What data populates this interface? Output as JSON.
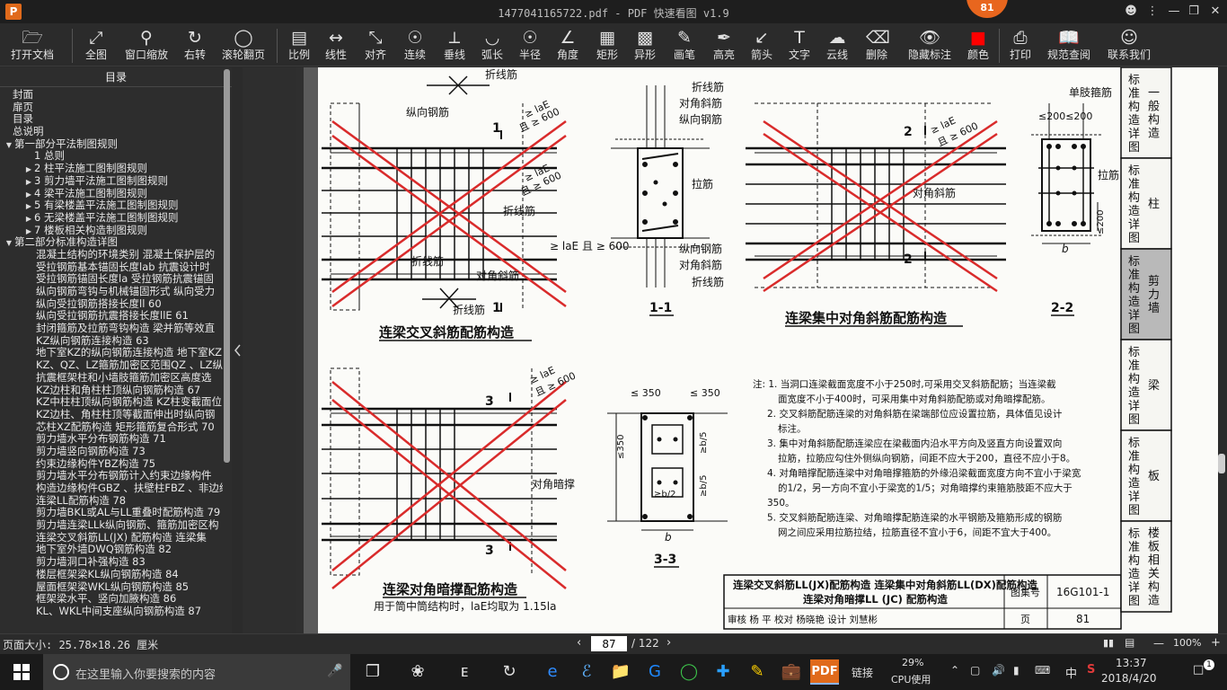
{
  "app": {
    "logo": "P",
    "title": "1477041165722.pdf - PDF 快速看图 v1.9",
    "badge": "81"
  },
  "toolbar": {
    "items": [
      {
        "label": "打开文档",
        "icon": "folder-icon"
      },
      {
        "label": "全图",
        "icon": "fit-all-icon"
      },
      {
        "label": "窗口缩放",
        "icon": "zoom-window-icon"
      },
      {
        "label": "右转",
        "icon": "rotate-right-icon"
      },
      {
        "label": "滚轮翻页",
        "icon": "mouse-wheel-icon"
      },
      {
        "label": "比例",
        "icon": "ruler-icon"
      },
      {
        "label": "线性",
        "icon": "linear-measure-icon"
      },
      {
        "label": "对齐",
        "icon": "aligned-measure-icon"
      },
      {
        "label": "连续",
        "icon": "continuous-measure-icon"
      },
      {
        "label": "垂线",
        "icon": "perpendicular-icon"
      },
      {
        "label": "弧长",
        "icon": "arc-length-icon"
      },
      {
        "label": "半径",
        "icon": "radius-icon"
      },
      {
        "label": "角度",
        "icon": "angle-icon"
      },
      {
        "label": "矩形",
        "icon": "rectangle-area-icon"
      },
      {
        "label": "异形",
        "icon": "polygon-area-icon"
      },
      {
        "label": "画笔",
        "icon": "pen-icon"
      },
      {
        "label": "高亮",
        "icon": "highlighter-icon"
      },
      {
        "label": "箭头",
        "icon": "arrow-icon"
      },
      {
        "label": "文字",
        "icon": "text-icon"
      },
      {
        "label": "云线",
        "icon": "cloud-line-icon"
      },
      {
        "label": "删除",
        "icon": "eraser-icon"
      },
      {
        "label": "隐藏标注",
        "icon": "hide-markup-icon"
      },
      {
        "label": "颜色",
        "icon": "color-swatch-icon"
      },
      {
        "label": "打印",
        "icon": "printer-icon"
      },
      {
        "label": "规范查阅",
        "icon": "book-icon"
      },
      {
        "label": "联系我们",
        "icon": "support-icon"
      }
    ],
    "color_swatch": "#ff0000"
  },
  "sidebar": {
    "title": "目录",
    "items": [
      {
        "level": 1,
        "toggle": "",
        "label": "封面"
      },
      {
        "level": 1,
        "toggle": "",
        "label": "扉页"
      },
      {
        "level": 1,
        "toggle": "",
        "label": "目录"
      },
      {
        "level": 1,
        "toggle": "",
        "label": "总说明"
      },
      {
        "level": 0,
        "toggle": "▼",
        "label": "第一部分平法制图规则"
      },
      {
        "level": 2,
        "toggle": "",
        "label": "1 总则"
      },
      {
        "level": 2,
        "toggle": "▶",
        "label": "2 柱平法施工图制图规则"
      },
      {
        "level": 2,
        "toggle": "▶",
        "label": "3 剪力墙平法施工图制图规则"
      },
      {
        "level": 2,
        "toggle": "▶",
        "label": "4 梁平法施工图制图规则"
      },
      {
        "level": 2,
        "toggle": "▶",
        "label": "5 有梁楼盖平法施工图制图规则"
      },
      {
        "level": 2,
        "toggle": "▶",
        "label": "6 无梁楼盖平法施工图制图规则"
      },
      {
        "level": 2,
        "toggle": "▶",
        "label": "7 楼板相关构造制图规则"
      },
      {
        "level": 0,
        "toggle": "▼",
        "label": "第二部分标准构造详图"
      },
      {
        "level": 3,
        "toggle": "",
        "label": "混凝土结构的环境类别  混凝土保护层的"
      },
      {
        "level": 3,
        "toggle": "",
        "label": "受拉钢筋基本锚固长度lab  抗震设计时"
      },
      {
        "level": 3,
        "toggle": "",
        "label": "受拉钢筋锚固长度la  受拉钢筋抗震锚固"
      },
      {
        "level": 3,
        "toggle": "",
        "label": "纵向钢筋弯钩与机械锚固形式  纵向受力"
      },
      {
        "level": 3,
        "toggle": "",
        "label": "纵向受拉钢筋搭接长度ll 60"
      },
      {
        "level": 3,
        "toggle": "",
        "label": "纵向受拉钢筋抗震搭接长度llE 61"
      },
      {
        "level": 3,
        "toggle": "",
        "label": "封闭箍筋及拉筋弯钩构造  梁并筋等效直"
      },
      {
        "level": 3,
        "toggle": "",
        "label": "KZ纵向钢筋连接构造 63"
      },
      {
        "level": 3,
        "toggle": "",
        "label": "地下室KZ的纵向钢筋连接构造  地下室KZ"
      },
      {
        "level": 3,
        "toggle": "",
        "label": "KZ、QZ、LZ箍筋加密区范围QZ 、LZ纵向"
      },
      {
        "level": 3,
        "toggle": "",
        "label": "抗震框架柱和小墙肢箍筋加密区高度选"
      },
      {
        "level": 3,
        "toggle": "",
        "label": "KZ边柱和角柱柱顶纵向钢筋构造 67"
      },
      {
        "level": 3,
        "toggle": "",
        "label": "KZ中柱柱顶纵向钢筋构造  KZ柱变截面位"
      },
      {
        "level": 3,
        "toggle": "",
        "label": "KZ边柱、角柱柱顶等截面伸出时纵向钢"
      },
      {
        "level": 3,
        "toggle": "",
        "label": "芯柱XZ配筋构造  矩形箍筋复合形式 70"
      },
      {
        "level": 3,
        "toggle": "",
        "label": "剪力墙水平分布钢筋构造 71"
      },
      {
        "level": 3,
        "toggle": "",
        "label": "剪力墙竖向钢筋构造 73"
      },
      {
        "level": 3,
        "toggle": "",
        "label": "约束边缘构件YBZ构造 75"
      },
      {
        "level": 3,
        "toggle": "",
        "label": "剪力墙水平分布钢筋计入约束边缘构件"
      },
      {
        "level": 3,
        "toggle": "",
        "label": "构造边缘构件GBZ 、扶壁柱FBZ 、非边缘"
      },
      {
        "level": 3,
        "toggle": "",
        "label": "连梁LL配筋构造 78"
      },
      {
        "level": 3,
        "toggle": "",
        "label": "剪力墙BKL或AL与LL重叠时配筋构造 79"
      },
      {
        "level": 3,
        "toggle": "",
        "label": "剪力墙连梁LLk纵向钢筋、箍筋加密区构"
      },
      {
        "level": 3,
        "toggle": "",
        "label": "连梁交叉斜筋LL(JX) 配筋构造  连梁集"
      },
      {
        "level": 3,
        "toggle": "",
        "label": "地下室外墙DWQ钢筋构造 82"
      },
      {
        "level": 3,
        "toggle": "",
        "label": "剪力墙洞口补强构造 83"
      },
      {
        "level": 3,
        "toggle": "",
        "label": "楼层框架梁KL纵向钢筋构造 84"
      },
      {
        "level": 3,
        "toggle": "",
        "label": "屋面框架梁WKL纵向钢筋构造 85"
      },
      {
        "level": 3,
        "toggle": "",
        "label": "框架梁水平、竖向加腋构造 86"
      },
      {
        "level": 3,
        "toggle": "",
        "label": "KL、WKL中间支座纵向钢筋构造 87"
      }
    ]
  },
  "drawing": {
    "fig1": {
      "title": "连梁交叉斜筋配筋构造",
      "labels": {
        "zhexianjin": "折线筋",
        "zongxiang": "纵向钢筋",
        "duijiao": "对角斜筋",
        "lae1": "≥ laE",
        "ge600": "且 ≥ 600",
        "lae_line": "≥ laE 且 ≥ 600",
        "sec": "1"
      }
    },
    "sec11": {
      "title": "1-1",
      "labels": [
        "折线筋",
        "对角斜筋",
        "纵向钢筋",
        "拉筋",
        "纵向钢筋",
        "对角斜筋",
        "折线筋"
      ]
    },
    "fig2": {
      "title": "连梁集中对角斜筋配筋构造",
      "labels": {
        "duijiao": "对角斜筋",
        "lae": "≥ laE",
        "ge600": "且 ≥ 600",
        "sec": "2"
      }
    },
    "sec22": {
      "title": "2-2",
      "labels": {
        "danzhi": "单肢箍筋",
        "spacing": "≤200≤200",
        "lajin": "拉筋",
        "dim200": "≤200",
        "b": "b"
      }
    },
    "fig3": {
      "title": "连梁对角暗撑配筋构造",
      "subtitle": "用于筒中筒结构时，laE均取为 1.15la",
      "labels": {
        "anchang": "对角暗撑",
        "lae": "≥ laE",
        "ge600": "且 ≥ 600",
        "sec": "3"
      }
    },
    "sec33": {
      "title": "3-3",
      "labels": {
        "s350a": "≤ 350",
        "s350b": "≤ 350",
        "v350": "≤350",
        "b5a": "≥b/5",
        "b5b": "≥b/5",
        "b2": "≥b/2",
        "b": "b"
      }
    },
    "notes": [
      "注: 1. 当洞口连梁截面宽度不小于250时,可采用交叉斜筋配筋；当连梁截",
      "面宽度不小于400时，可采用集中对角斜筋配筋或对角暗撑配筋。",
      "2. 交叉斜筋配筋连梁的对角斜筋在梁端部位应设置拉筋，具体值见设计",
      "标注。",
      "3. 集中对角斜筋配筋连梁应在梁截面内沿水平方向及竖直方向设置双向",
      "拉筋，拉筋应勾住外侧纵向钢筋，间距不应大于200，直径不应小于8。",
      "4. 对角暗撑配筋连梁中对角暗撑箍筋的外缘沿梁截面宽度方向不宜小于梁宽",
      "的1/2，另一方向不宜小于梁宽的1/5；对角暗撑约束箍筋肢距不应大于",
      "350。",
      "5. 交叉斜筋配筋连梁、对角暗撑配筋连梁的水平钢筋及箍筋形成的钢筋",
      "网之间应采用拉筋拉结，拉筋直径不宜小于6，间距不宜大于400。"
    ],
    "title_block": {
      "line1": "连梁交叉斜筋LL(JX)配筋构造  连梁集中对角斜筋LL(DX)配筋构造",
      "line2": "连梁对角暗撑LL (JC) 配筋构造",
      "atlas_label": "图集号",
      "atlas_no": "16G101-1",
      "review_row": "审核 杨 平   校对 杨晓艳   设计 刘慧彬",
      "page_label": "页",
      "page_no": "81"
    },
    "side_tabs": [
      {
        "main": "标准构造详图",
        "sub": "一般构造"
      },
      {
        "main": "标准构造详图",
        "sub": "柱"
      },
      {
        "main": "标准构造详图",
        "sub": "剪力墙"
      },
      {
        "main": "标准构造详图",
        "sub": "梁"
      },
      {
        "main": "标准构造详图",
        "sub": "板"
      },
      {
        "main": "标准构造详图",
        "sub": "楼板相关构造"
      }
    ],
    "active_tab": 2
  },
  "status": {
    "page_size": "页面大小: 25.78×18.26 厘米",
    "page_current": "87",
    "page_total": "/ 122",
    "zoom": "100%"
  },
  "taskbar": {
    "search_placeholder": "在这里输入你要搜索的内容",
    "cpu_pct": "29%",
    "cpu_label": "CPU使用",
    "link_label": "链接",
    "ime": "中",
    "time": "13:37",
    "date": "2018/4/20",
    "notifications": "1"
  }
}
